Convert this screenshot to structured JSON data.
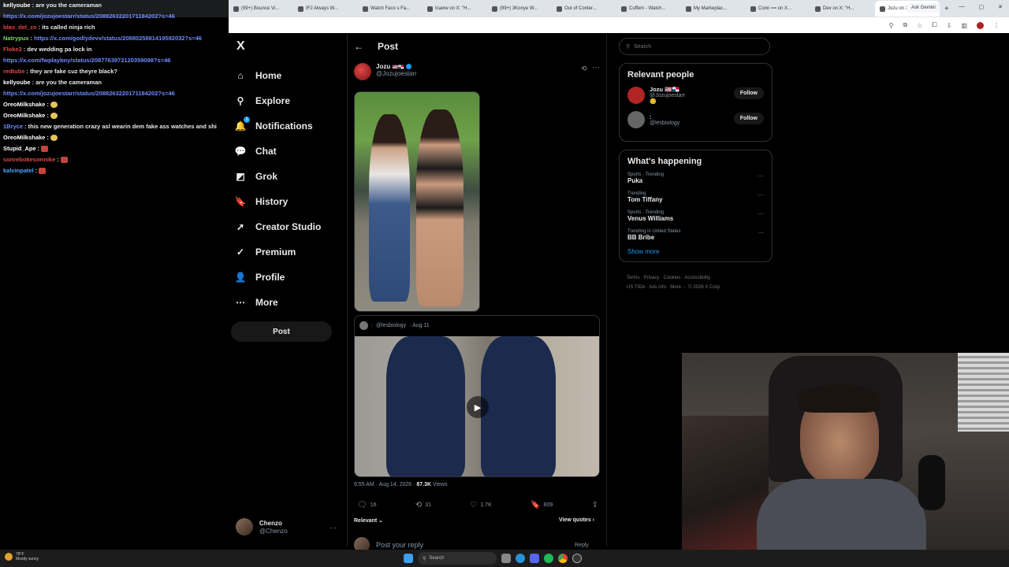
{
  "browser": {
    "tabs": [
      {
        "label": "(99+) Bounce Vi..."
      },
      {
        "label": "IF2 Always W..."
      },
      {
        "label": "Watch Faco s Fa..."
      },
      {
        "label": "Icaww on X: \"H..."
      },
      {
        "label": "(99+) 3Konye W..."
      },
      {
        "label": "Out of Conter..."
      },
      {
        "label": "Cuffem - Watch..."
      },
      {
        "label": "My Markeplac..."
      },
      {
        "label": "Conn == on X..."
      },
      {
        "label": "Dev on X: \"H..."
      },
      {
        "label": "Jozu on X..."
      }
    ],
    "new_tab_glyph": "+",
    "ask_gemini": "Ask Gemini"
  },
  "chat": {
    "messages": [
      {
        "user": "kellyoube",
        "user_color": "#ffffff",
        "text": ": are you the cameraman",
        "link": ""
      },
      {
        "user": "",
        "user_color": "#ffffff",
        "text": "",
        "link": "https://x.com/jozujoestarr/status/2088263220171184202?s=46"
      },
      {
        "user": "blas_del_zo",
        "user_color": "#e04848",
        "text": ": its called ninja rich",
        "link": ""
      },
      {
        "user": "Natrypux",
        "user_color": "#7fd36a",
        "text": ": ",
        "link": "https://x.com/godlydevv/status/2088025881419592032?s=46"
      },
      {
        "user": "Floke2",
        "user_color": "#e04848",
        "text": ": dev wedding pa lock in",
        "link": ""
      },
      {
        "user": "",
        "user_color": "#ffffff",
        "text": "",
        "link": "https://x.com/fwplayboy/status/2087763972120359098?s=46"
      },
      {
        "user": "redtube",
        "user_color": "#e04848",
        "text": ": they are fake cuz theyre black?",
        "link": ""
      },
      {
        "user": "kellyoube",
        "user_color": "#ffffff",
        "text": ": are you the cameraman",
        "link": ""
      },
      {
        "user": "",
        "user_color": "#ffffff",
        "text": "",
        "link": "https://x.com/jozujoestarr/status/2088263220171184202?s=46"
      },
      {
        "user": "OreoMilkshake",
        "user_color": "#ffffff",
        "text": ": ",
        "link": "",
        "emote": "thumb"
      },
      {
        "user": "OreoMilkshake",
        "user_color": "#ffffff",
        "text": ": ",
        "link": "",
        "emote": "thumb"
      },
      {
        "user": "1Bryce",
        "user_color": "#6f8cff",
        "text": ": this new generation crazy asl wearin dem fake ass watches and shi",
        "link": ""
      },
      {
        "user": "OreoMilkshake",
        "user_color": "#ffffff",
        "text": ": ",
        "link": "",
        "emote": "thumb"
      },
      {
        "user": "Stupid_Ape",
        "user_color": "#ffffff",
        "text": ": ",
        "link": "",
        "emote": "red"
      },
      {
        "user": "sonrebokesonnike",
        "user_color": "#e04848",
        "text": ": ",
        "link": "",
        "emote": "red"
      },
      {
        "user": "kalvinpatel",
        "user_color": "#4fa3ff",
        "text": ": ",
        "link": "",
        "emote": "red"
      }
    ]
  },
  "sidebar": {
    "logo": "X",
    "items": [
      {
        "label": "Home",
        "icon": "⌂",
        "name": "home"
      },
      {
        "label": "Explore",
        "icon": "⚲",
        "name": "explore"
      },
      {
        "label": "Notifications",
        "icon": "🔔",
        "name": "notifications",
        "badge": "1"
      },
      {
        "label": "Chat",
        "icon": "💬",
        "name": "chat"
      },
      {
        "label": "Grok",
        "icon": "◩",
        "name": "grok"
      },
      {
        "label": "History",
        "icon": "🔖",
        "name": "history"
      },
      {
        "label": "Creator Studio",
        "icon": "➚",
        "name": "creator-studio"
      },
      {
        "label": "Premium",
        "icon": "✓",
        "name": "premium"
      },
      {
        "label": "Profile",
        "icon": "👤",
        "name": "profile"
      },
      {
        "label": "More",
        "icon": "⋯",
        "name": "more"
      }
    ],
    "post_button": "Post",
    "account": {
      "name": "Chenzo",
      "handle": "@Chenzo",
      "more": "···"
    }
  },
  "post": {
    "header_title": "Post",
    "back_glyph": "←",
    "author": {
      "name": "Jozu",
      "flag": "🇺🇸🇵🇦",
      "handle": "@Jozujoestarr"
    },
    "menu_glyph": "···",
    "quote": {
      "name": ":",
      "handle": "@lesbiology",
      "date": "· Aug 11"
    },
    "meta": {
      "time": "6:55 AM · Aug 14, 2026 · ",
      "views": "87.3K",
      "views_label": " Views"
    },
    "actions": {
      "replies": "16",
      "reposts": "31",
      "likes": "1.7K",
      "bookmarks": "809"
    },
    "relevant": "Relevant ⌄",
    "view_quotes": "View quotes ›",
    "reply_placeholder": "Post your reply",
    "reply_btn": "Reply"
  },
  "right": {
    "search_placeholder": "Search",
    "relevant_title": "Relevant people",
    "people": [
      {
        "name": "Jozu 🇺🇸🇵🇦",
        "handle": "@Jozujoestarr",
        "bio": "😊",
        "follow": "Follow",
        "avatar_color": "#b02424"
      },
      {
        "name": ":",
        "handle": "@lesbiology",
        "bio": "",
        "follow": "Follow",
        "avatar_color": "#666666"
      }
    ],
    "happening_title": "What's happening",
    "trends": [
      {
        "category": "Sports · Trending",
        "name": "Puka"
      },
      {
        "category": "Trending",
        "name": "Tom Tiffany"
      },
      {
        "category": "Sports · Trending",
        "name": "Venus Williams"
      },
      {
        "category": "Trending in United States",
        "name": "BB Bribe"
      }
    ],
    "show_more": "Show more",
    "footer_line1": "Terms · Privacy · Cookies · Accessibility ·",
    "footer_line2": "US TIDA · Ads info · More ··· © 2026 X Corp."
  },
  "taskbar": {
    "weather_temp": "78°F",
    "weather_desc": "Mostly sunny",
    "search": "Search"
  }
}
